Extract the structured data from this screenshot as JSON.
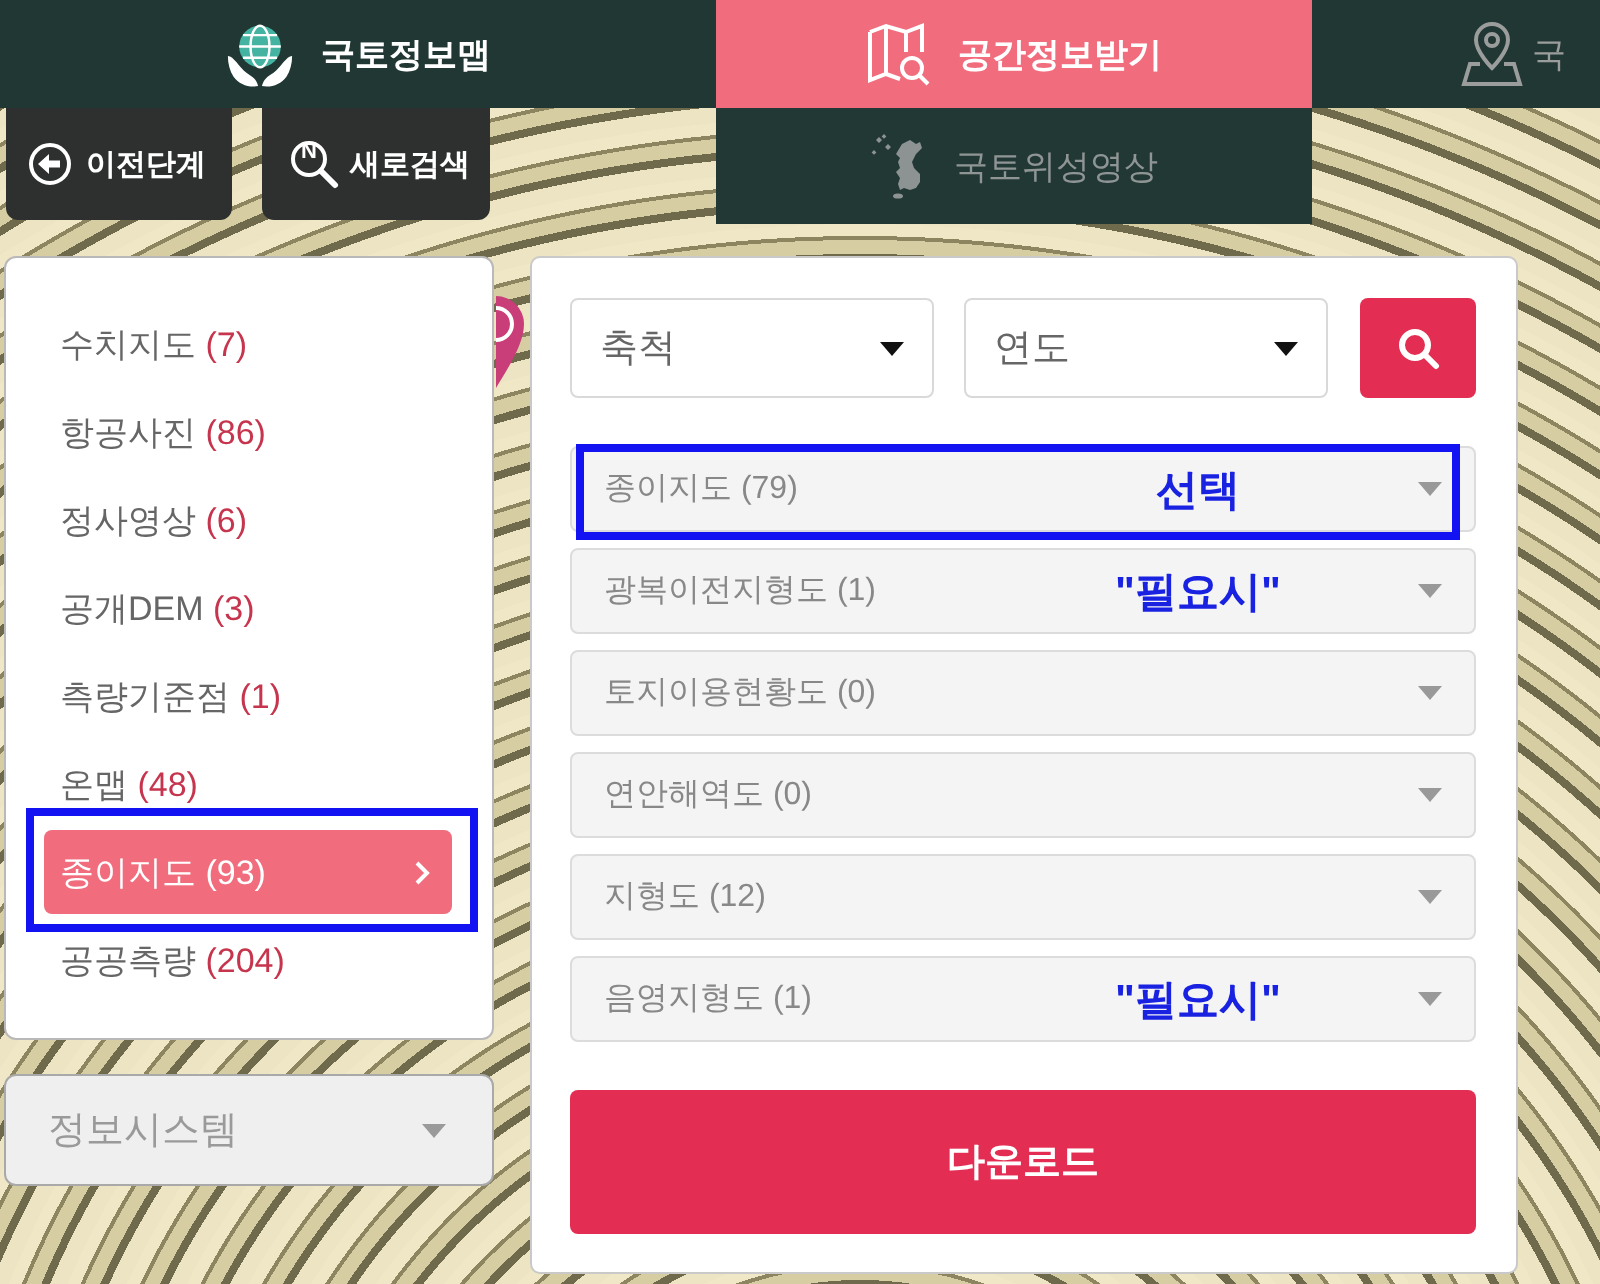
{
  "nav_tabs": [
    {
      "label": "국토정보맵",
      "selected": false,
      "dimmed": false
    },
    {
      "label": "공간정보받기",
      "selected": true,
      "dimmed": false
    },
    {
      "label": "국",
      "selected": false,
      "dimmed": true
    }
  ],
  "toolbar_buttons": [
    {
      "label": "이전단계"
    },
    {
      "label": "새로검색",
      "icon_text": "N"
    }
  ],
  "sub_tab": {
    "label": "국토위성영상",
    "selected": false
  },
  "categories": [
    {
      "name": "수치지도",
      "count": "(7)",
      "selected": false,
      "framed": false
    },
    {
      "name": "항공사진",
      "count": "(86)",
      "selected": false,
      "framed": false
    },
    {
      "name": "정사영상",
      "count": "(6)",
      "selected": false,
      "framed": false
    },
    {
      "name": "공개DEM",
      "count": "(3)",
      "selected": false,
      "framed": false
    },
    {
      "name": "측량기준점",
      "count": "(1)",
      "selected": false,
      "framed": false
    },
    {
      "name": "온맵",
      "count": "(48)",
      "selected": false,
      "framed": false
    },
    {
      "name": "종이지도",
      "count": "(93)",
      "selected": true,
      "framed": true
    },
    {
      "name": "공공측량",
      "count": "(204)",
      "selected": false,
      "framed": false
    }
  ],
  "system_select": {
    "value": "정보시스템"
  },
  "filters": [
    {
      "value": "축척"
    },
    {
      "value": "연도"
    }
  ],
  "layers": [
    {
      "label": "종이지도 (79)",
      "framed": true,
      "note": "선택"
    },
    {
      "label": "광복이전지형도 (1)",
      "framed": false,
      "note": "\"필요시\""
    },
    {
      "label": "토지이용현황도 (0)",
      "framed": false
    },
    {
      "label": "연안해역도 (0)",
      "framed": false
    },
    {
      "label": "지형도 (12)",
      "framed": false
    },
    {
      "label": "음영지형도 (1)",
      "framed": false,
      "note": "\"필요시\""
    }
  ],
  "download_button": {
    "label": "다운로드"
  }
}
